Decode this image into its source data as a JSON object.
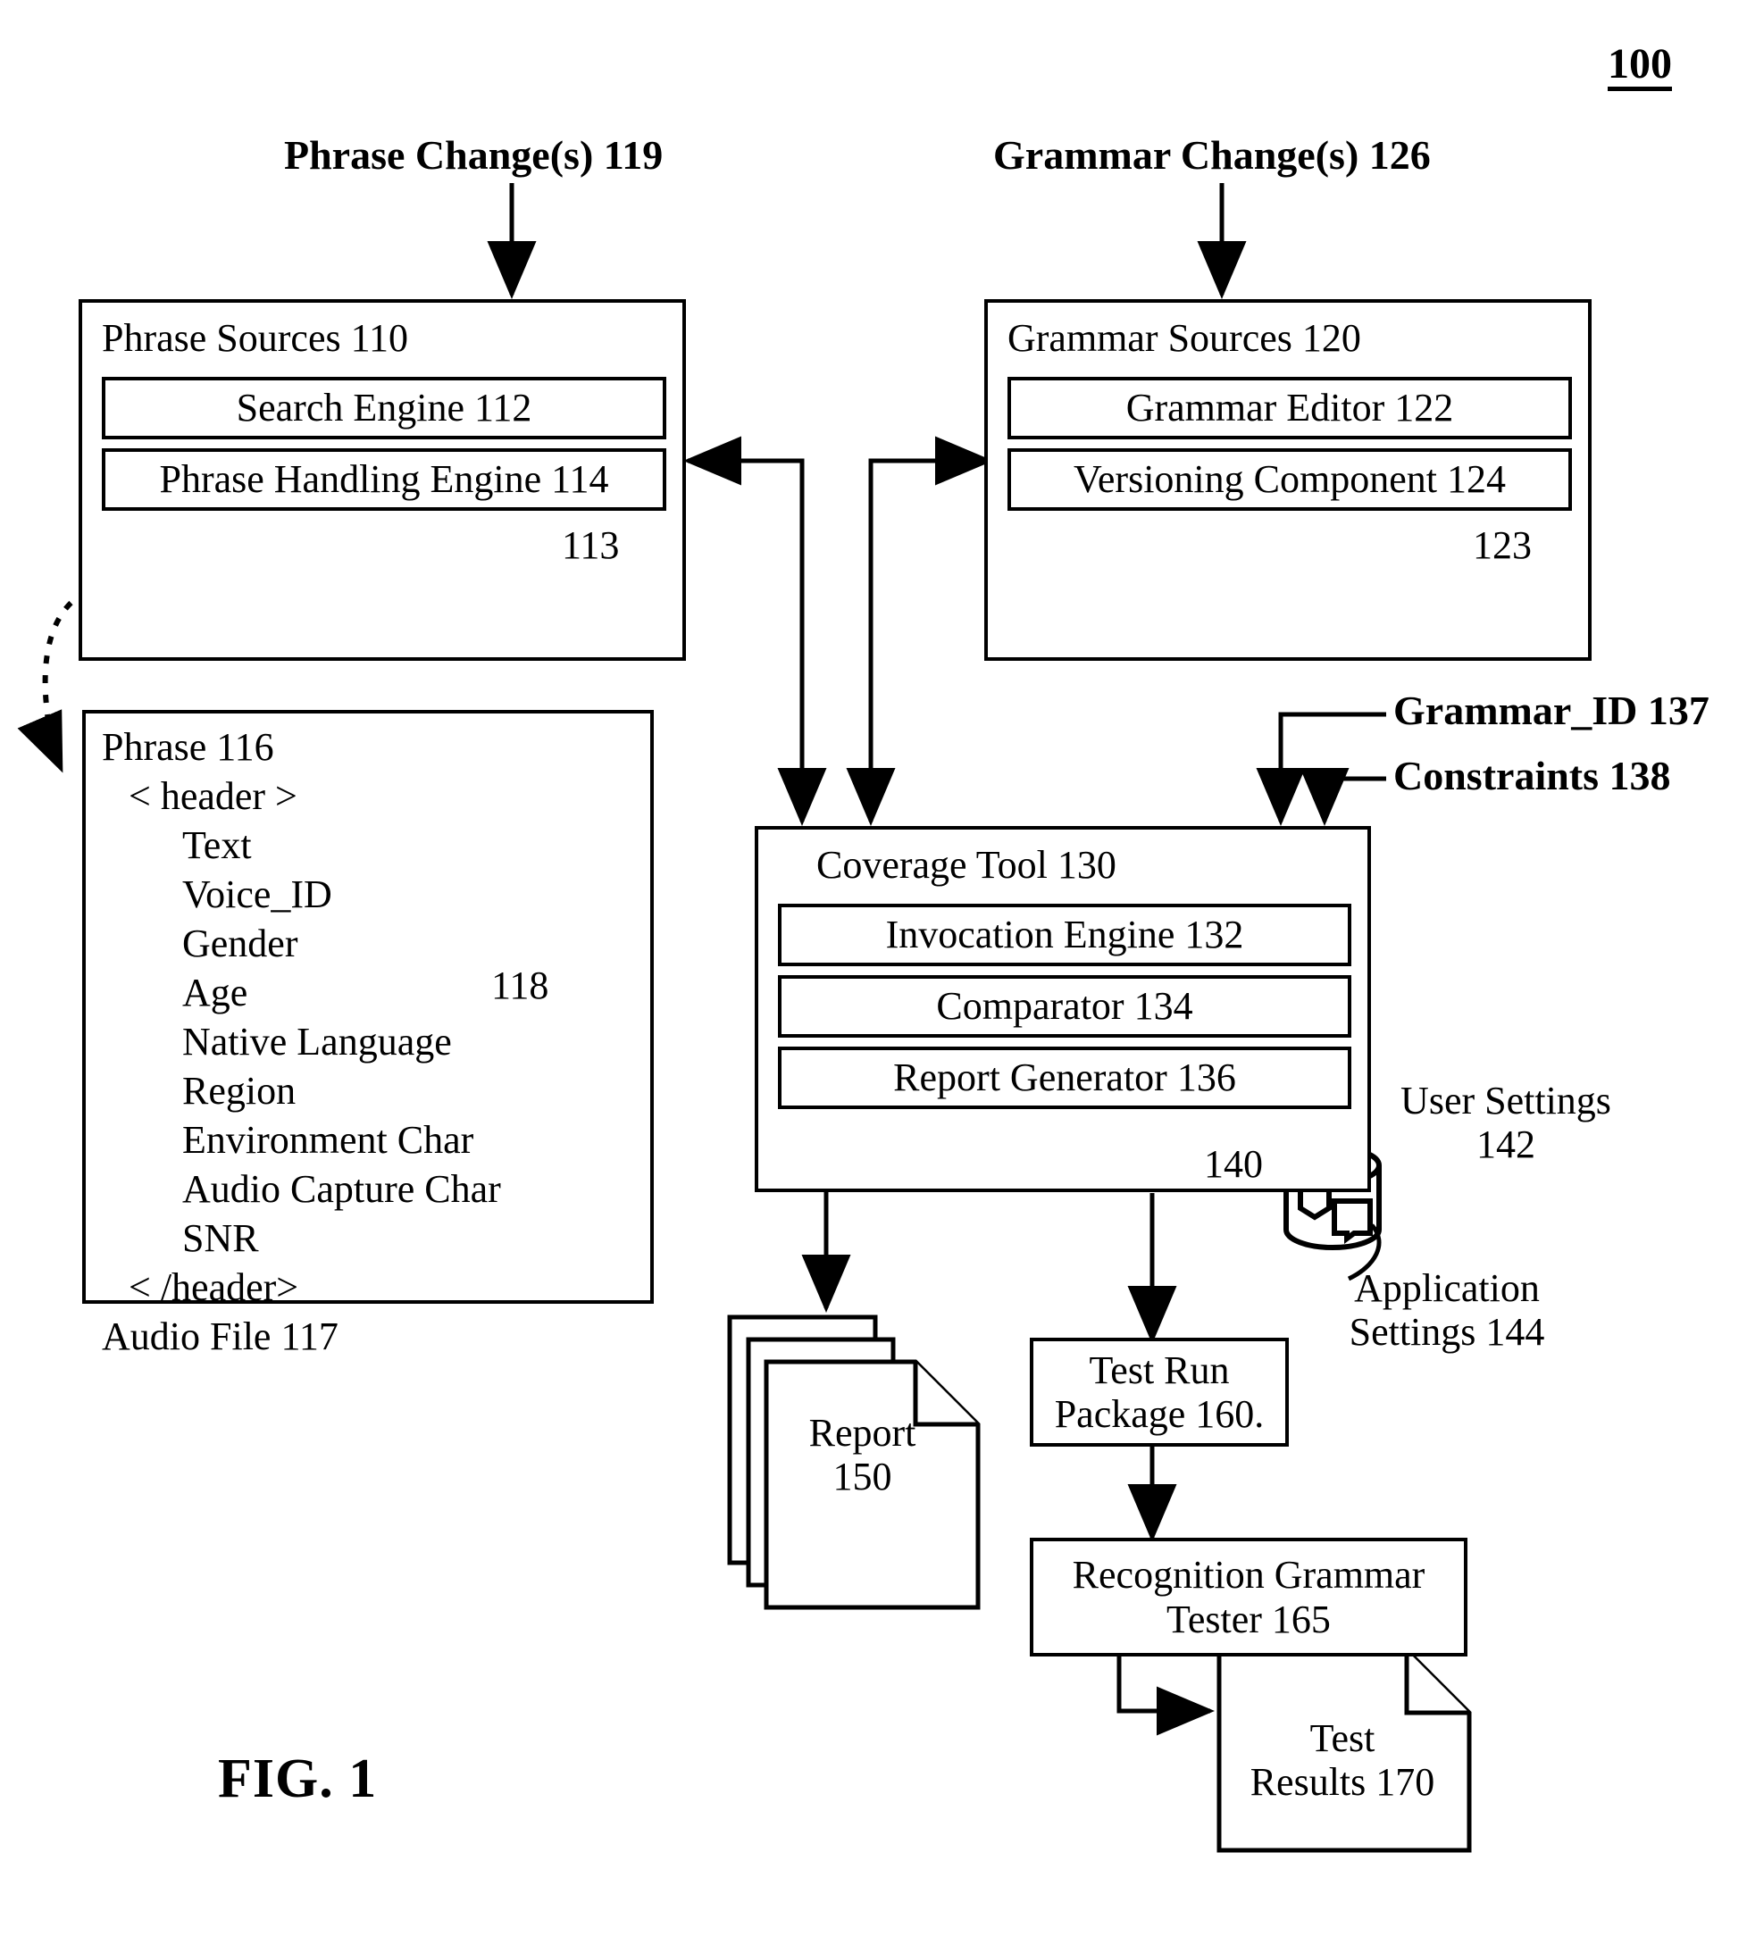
{
  "figure": {
    "number_top_right": "100",
    "caption": "FIG. 1"
  },
  "callouts": {
    "phrase_changes": "Phrase Change(s) 119",
    "grammar_changes": "Grammar Change(s) 126",
    "grammar_id": "Grammar_ID 137",
    "constraints": "Constraints 138"
  },
  "phrase_sources": {
    "title": "Phrase Sources 110",
    "components": [
      "Search Engine 112",
      "Phrase Handling Engine 114"
    ],
    "datastores": [
      "",
      "",
      "",
      "113"
    ]
  },
  "grammar_sources": {
    "title": "Grammar Sources 120",
    "components": [
      "Grammar Editor 122",
      "Versioning Component 124"
    ],
    "datastores": [
      "",
      "",
      "",
      "123"
    ]
  },
  "phrase_detail": {
    "title": "Phrase 116",
    "header_open": "< header >",
    "header_fields": [
      "Text",
      "Voice_ID",
      "Gender",
      "Age",
      "Native Language",
      "Region",
      "Environment Char",
      "Audio Capture Char",
      "SNR"
    ],
    "header_close": "< /header>",
    "audio_file": "Audio File 117",
    "brace_ref": "118"
  },
  "coverage_tool": {
    "title": "Coverage Tool 130",
    "components": [
      "Invocation Engine 132",
      "Comparator 134",
      "Report Generator 136"
    ]
  },
  "settings_store": {
    "ref": "140",
    "user_settings_line1": "User Settings",
    "user_settings_line2": "142",
    "application_settings_line1": "Application",
    "application_settings_line2": "Settings 144"
  },
  "outputs": {
    "report_line1": "Report",
    "report_line2": "150",
    "test_run_package_line1": "Test Run",
    "test_run_package_line2": "Package 160.",
    "recognition_tester_line1": "Recognition Grammar",
    "recognition_tester_line2": "Tester 165",
    "test_results_line1": "Test",
    "test_results_line2": "Results 170"
  },
  "colors": {
    "stroke": "#000000",
    "background": "#ffffff"
  }
}
